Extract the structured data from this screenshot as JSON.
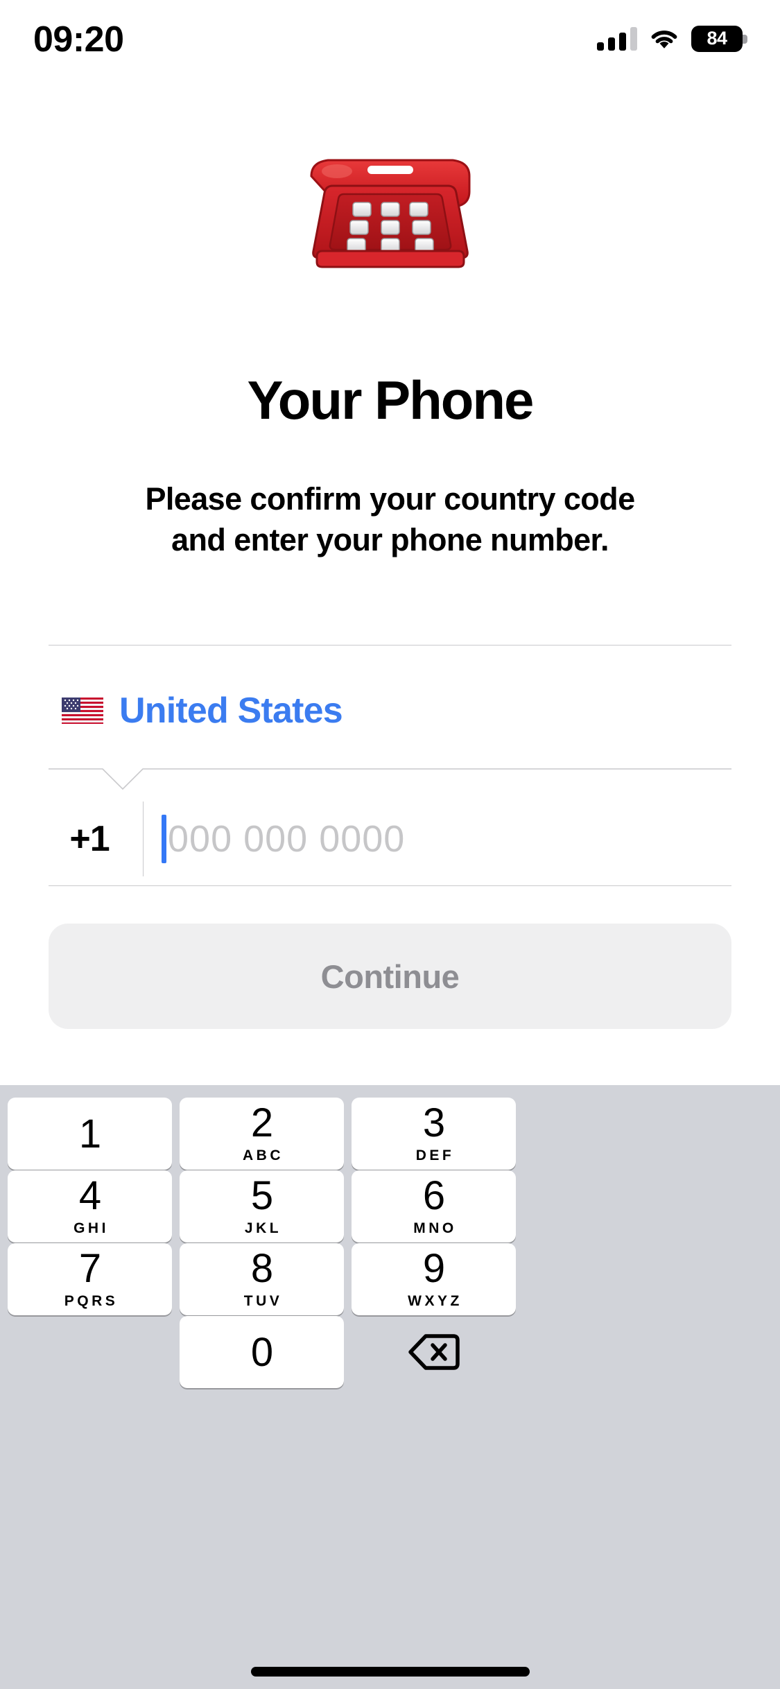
{
  "status_bar": {
    "time": "09:20",
    "battery_level": "84",
    "signal_icon": "cellular-bars-icon",
    "wifi_icon": "wifi-icon",
    "battery_icon": "battery-icon"
  },
  "hero": {
    "emoji_name": "telephone-emoji",
    "emoji_char": "☎️"
  },
  "title": "Your Phone",
  "subtitle_line1": "Please confirm your country code",
  "subtitle_line2": "and enter your phone number.",
  "form": {
    "country": {
      "flag_name": "flag-united-states-icon",
      "name": "United States"
    },
    "dial_code": "+1",
    "phone_placeholder": "000 000 0000",
    "phone_value": ""
  },
  "continue_label": "Continue",
  "keypad": {
    "rows": [
      [
        {
          "digit": "1",
          "letters": ""
        },
        {
          "digit": "2",
          "letters": "ABC"
        },
        {
          "digit": "3",
          "letters": "DEF"
        }
      ],
      [
        {
          "digit": "4",
          "letters": "GHI"
        },
        {
          "digit": "5",
          "letters": "JKL"
        },
        {
          "digit": "6",
          "letters": "MNO"
        }
      ],
      [
        {
          "digit": "7",
          "letters": "PQRS"
        },
        {
          "digit": "8",
          "letters": "TUV"
        },
        {
          "digit": "9",
          "letters": "WXYZ"
        }
      ]
    ],
    "zero_digit": "0",
    "backspace_icon": "backspace-icon"
  },
  "colors": {
    "accent_blue": "#3b7cf0",
    "caret_blue": "#3478f6",
    "placeholder_gray": "#c6c6c8",
    "divider_gray": "#c9c9cc",
    "button_bg": "#efeff0",
    "button_text": "#8e8e93",
    "keypad_bg": "#d1d3d9",
    "key_bg": "#ffffff"
  }
}
